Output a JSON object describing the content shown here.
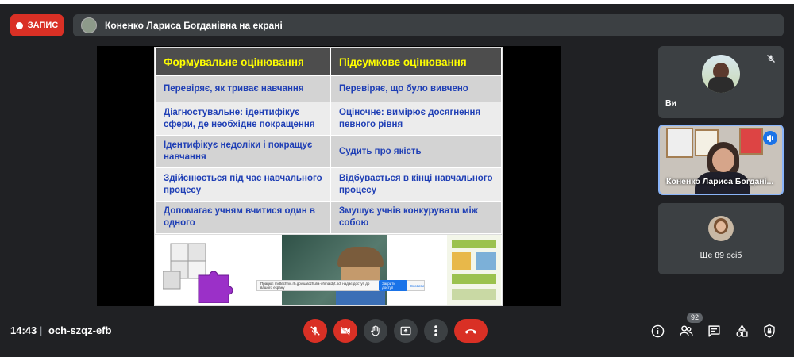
{
  "recording": {
    "label": "ЗАПИС"
  },
  "presenter_banner": {
    "text": "Коненко Лариса Богданівна на екрані"
  },
  "slide": {
    "headers": [
      "Формувальне оцінювання",
      "Підсумкове оцінювання"
    ],
    "rows": [
      [
        "Перевіряє, як триває навчання",
        "Перевіряє, що було вивчено"
      ],
      [
        "Діагностувальне: ідентифікує сфери, де необхідне покращення",
        "Оціночне: вимірює досягнення певного рівня"
      ],
      [
        "Ідентифікує недоліки і покращує навчання",
        "Судить про якість"
      ],
      [
        "Здійснюється під час навчального процесу",
        "Відбувається в кінці навчального процесу"
      ],
      [
        "Допомагає учням вчитися один в одного",
        "Змушує учнів конкурувати між собою"
      ]
    ],
    "share_notice": {
      "text": "Працює midtechnic.rh.gov.ua/dzhulia-ohmatdyt.pdf надає доступ до вашого екрану",
      "stop_button": "Закрити доступ",
      "hide_link": "Сховати"
    }
  },
  "participants": {
    "self": {
      "name": "Ви",
      "muted": true
    },
    "presenter": {
      "name": "Коненко Лариса Богдані...",
      "speaking": true
    },
    "others": {
      "label": "Ще 89 осіб"
    }
  },
  "bottom_bar": {
    "time": "14:43",
    "separator": "|",
    "meeting_code": "och-szqz-efb",
    "people_count": "92",
    "controls": [
      "mic-off-icon",
      "camera-off-icon",
      "raise-hand-icon",
      "present-screen-icon",
      "more-options-icon",
      "end-call-icon"
    ],
    "right_icons": [
      "info-icon",
      "people-icon",
      "chat-icon",
      "activities-icon",
      "host-controls-icon"
    ]
  },
  "colors": {
    "background": "#202124",
    "tile": "#3c4043",
    "danger": "#d93025",
    "accent": "#1a73e8",
    "slide_header_text": "#ffff00",
    "slide_body_text": "#1f3fb5"
  }
}
